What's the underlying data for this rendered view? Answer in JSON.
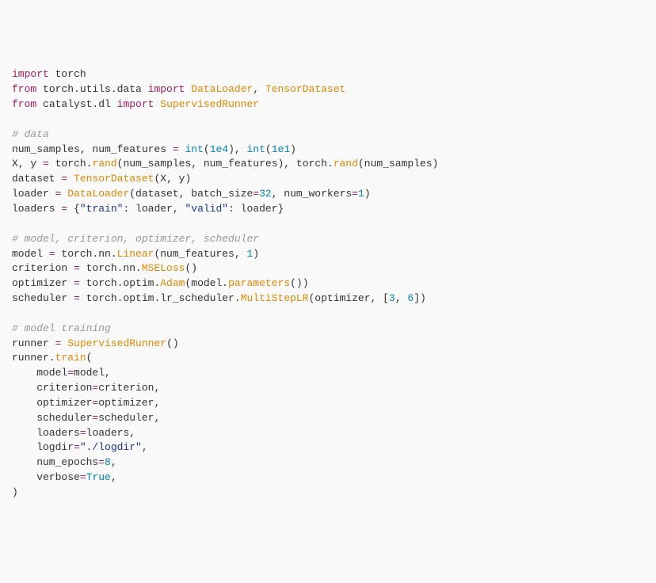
{
  "code": {
    "lines": [
      [
        {
          "t": "import",
          "c": "k"
        },
        {
          "t": " torch",
          "c": "nm"
        }
      ],
      [
        {
          "t": "from",
          "c": "k"
        },
        {
          "t": " torch.utils.data ",
          "c": "nm"
        },
        {
          "t": "import",
          "c": "k"
        },
        {
          "t": " ",
          "c": "nm"
        },
        {
          "t": "DataLoader",
          "c": "fn"
        },
        {
          "t": ", ",
          "c": "p"
        },
        {
          "t": "TensorDataset",
          "c": "fn"
        }
      ],
      [
        {
          "t": "from",
          "c": "k"
        },
        {
          "t": " catalyst.dl ",
          "c": "nm"
        },
        {
          "t": "import",
          "c": "k"
        },
        {
          "t": " ",
          "c": "nm"
        },
        {
          "t": "SupervisedRunner",
          "c": "fn"
        }
      ],
      [],
      [
        {
          "t": "# data",
          "c": "cm"
        }
      ],
      [
        {
          "t": "num_samples, num_features ",
          "c": "nm"
        },
        {
          "t": "=",
          "c": "op"
        },
        {
          "t": " ",
          "c": "nm"
        },
        {
          "t": "int",
          "c": "blu"
        },
        {
          "t": "(",
          "c": "p"
        },
        {
          "t": "1e4",
          "c": "blu"
        },
        {
          "t": "), ",
          "c": "p"
        },
        {
          "t": "int",
          "c": "blu"
        },
        {
          "t": "(",
          "c": "p"
        },
        {
          "t": "1e1",
          "c": "blu"
        },
        {
          "t": ")",
          "c": "p"
        }
      ],
      [
        {
          "t": "X, y ",
          "c": "nm"
        },
        {
          "t": "=",
          "c": "op"
        },
        {
          "t": " torch.",
          "c": "nm"
        },
        {
          "t": "rand",
          "c": "fn"
        },
        {
          "t": "(num_samples, num_features), torch.",
          "c": "nm"
        },
        {
          "t": "rand",
          "c": "fn"
        },
        {
          "t": "(num_samples)",
          "c": "nm"
        }
      ],
      [
        {
          "t": "dataset ",
          "c": "nm"
        },
        {
          "t": "=",
          "c": "op"
        },
        {
          "t": " ",
          "c": "nm"
        },
        {
          "t": "TensorDataset",
          "c": "fn"
        },
        {
          "t": "(X, y)",
          "c": "nm"
        }
      ],
      [
        {
          "t": "loader ",
          "c": "nm"
        },
        {
          "t": "=",
          "c": "op"
        },
        {
          "t": " ",
          "c": "nm"
        },
        {
          "t": "DataLoader",
          "c": "fn"
        },
        {
          "t": "(dataset, batch_size",
          "c": "nm"
        },
        {
          "t": "=",
          "c": "op"
        },
        {
          "t": "32",
          "c": "blu"
        },
        {
          "t": ", num_workers",
          "c": "nm"
        },
        {
          "t": "=",
          "c": "op"
        },
        {
          "t": "1",
          "c": "blu"
        },
        {
          "t": ")",
          "c": "p"
        }
      ],
      [
        {
          "t": "loaders ",
          "c": "nm"
        },
        {
          "t": "=",
          "c": "op"
        },
        {
          "t": " {",
          "c": "p"
        },
        {
          "t": "\"train\"",
          "c": "str"
        },
        {
          "t": ": loader, ",
          "c": "nm"
        },
        {
          "t": "\"valid\"",
          "c": "str"
        },
        {
          "t": ": loader}",
          "c": "nm"
        }
      ],
      [],
      [
        {
          "t": "# model, criterion, optimizer, scheduler",
          "c": "cm"
        }
      ],
      [
        {
          "t": "model ",
          "c": "nm"
        },
        {
          "t": "=",
          "c": "op"
        },
        {
          "t": " torch.nn.",
          "c": "nm"
        },
        {
          "t": "Linear",
          "c": "fn"
        },
        {
          "t": "(num_features, ",
          "c": "nm"
        },
        {
          "t": "1",
          "c": "blu"
        },
        {
          "t": ")",
          "c": "p"
        }
      ],
      [
        {
          "t": "criterion ",
          "c": "nm"
        },
        {
          "t": "=",
          "c": "op"
        },
        {
          "t": " torch.nn.",
          "c": "nm"
        },
        {
          "t": "MSELoss",
          "c": "fn"
        },
        {
          "t": "()",
          "c": "p"
        }
      ],
      [
        {
          "t": "optimizer ",
          "c": "nm"
        },
        {
          "t": "=",
          "c": "op"
        },
        {
          "t": " torch.optim.",
          "c": "nm"
        },
        {
          "t": "Adam",
          "c": "fn"
        },
        {
          "t": "(model.",
          "c": "nm"
        },
        {
          "t": "parameters",
          "c": "fn"
        },
        {
          "t": "())",
          "c": "p"
        }
      ],
      [
        {
          "t": "scheduler ",
          "c": "nm"
        },
        {
          "t": "=",
          "c": "op"
        },
        {
          "t": " torch.optim.lr_scheduler.",
          "c": "nm"
        },
        {
          "t": "MultiStepLR",
          "c": "fn"
        },
        {
          "t": "(optimizer, [",
          "c": "nm"
        },
        {
          "t": "3",
          "c": "blu"
        },
        {
          "t": ", ",
          "c": "p"
        },
        {
          "t": "6",
          "c": "blu"
        },
        {
          "t": "])",
          "c": "p"
        }
      ],
      [],
      [
        {
          "t": "# model training",
          "c": "cm"
        }
      ],
      [
        {
          "t": "runner ",
          "c": "nm"
        },
        {
          "t": "=",
          "c": "op"
        },
        {
          "t": " ",
          "c": "nm"
        },
        {
          "t": "SupervisedRunner",
          "c": "fn"
        },
        {
          "t": "()",
          "c": "p"
        }
      ],
      [
        {
          "t": "runner.",
          "c": "nm"
        },
        {
          "t": "train",
          "c": "fn"
        },
        {
          "t": "(",
          "c": "p"
        }
      ],
      [
        {
          "t": "    model",
          "c": "nm"
        },
        {
          "t": "=",
          "c": "op"
        },
        {
          "t": "model,",
          "c": "nm"
        }
      ],
      [
        {
          "t": "    criterion",
          "c": "nm"
        },
        {
          "t": "=",
          "c": "op"
        },
        {
          "t": "criterion,",
          "c": "nm"
        }
      ],
      [
        {
          "t": "    optimizer",
          "c": "nm"
        },
        {
          "t": "=",
          "c": "op"
        },
        {
          "t": "optimizer,",
          "c": "nm"
        }
      ],
      [
        {
          "t": "    scheduler",
          "c": "nm"
        },
        {
          "t": "=",
          "c": "op"
        },
        {
          "t": "scheduler,",
          "c": "nm"
        }
      ],
      [
        {
          "t": "    loaders",
          "c": "nm"
        },
        {
          "t": "=",
          "c": "op"
        },
        {
          "t": "loaders,",
          "c": "nm"
        }
      ],
      [
        {
          "t": "    logdir",
          "c": "nm"
        },
        {
          "t": "=",
          "c": "op"
        },
        {
          "t": "\"./logdir\"",
          "c": "str"
        },
        {
          "t": ",",
          "c": "p"
        }
      ],
      [
        {
          "t": "    num_epochs",
          "c": "nm"
        },
        {
          "t": "=",
          "c": "op"
        },
        {
          "t": "8",
          "c": "blu"
        },
        {
          "t": ",",
          "c": "p"
        }
      ],
      [
        {
          "t": "    verbose",
          "c": "nm"
        },
        {
          "t": "=",
          "c": "op"
        },
        {
          "t": "True",
          "c": "blu"
        },
        {
          "t": ",",
          "c": "p"
        }
      ],
      [
        {
          "t": ")",
          "c": "p"
        }
      ]
    ]
  }
}
